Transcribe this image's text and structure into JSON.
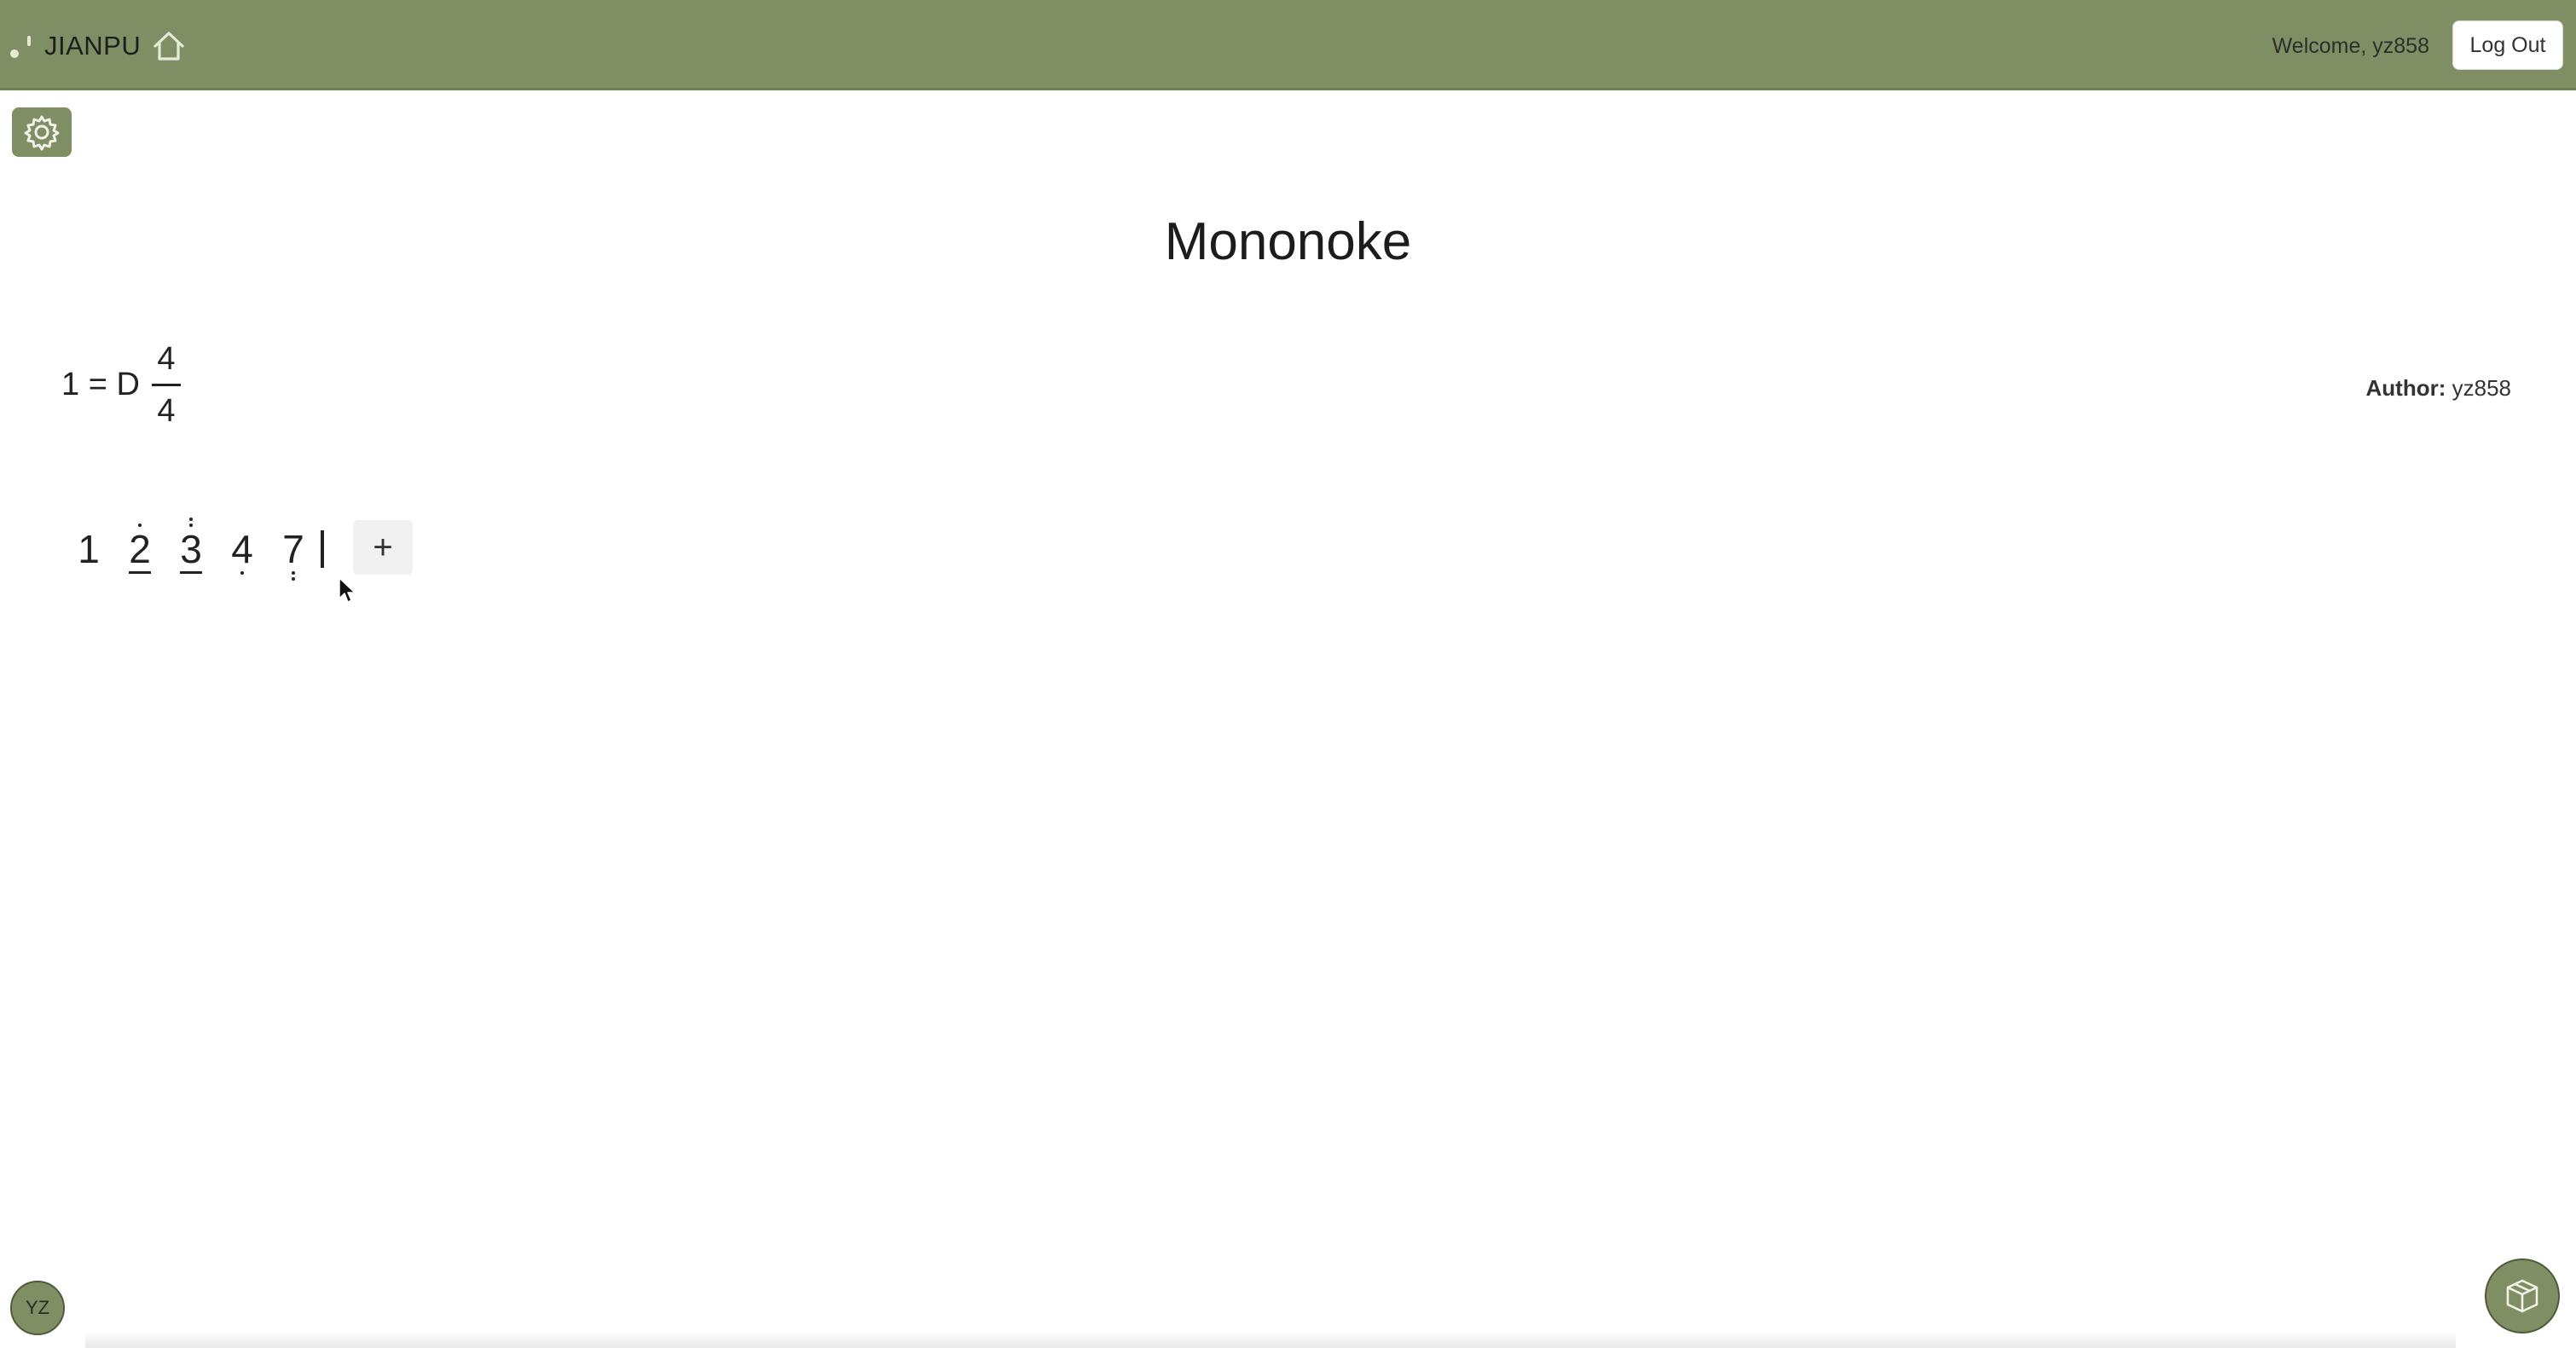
{
  "navbar": {
    "brand": "JIANPU",
    "welcome": "Welcome, yz858",
    "logout_label": "Log Out",
    "background_color": "#7f8f63"
  },
  "icons": {
    "home": "home-icon",
    "settings": "gear-icon",
    "cube": "cube-icon"
  },
  "score": {
    "title": "Mononoke",
    "key_label": "1 = D",
    "time_signature": {
      "numerator": "4",
      "denominator": "4"
    },
    "author_label": "Author:",
    "author_name": "yz858",
    "notes": [
      {
        "digit": "1",
        "dots_above": 0,
        "dots_below": 0,
        "underlines": 0
      },
      {
        "digit": "2",
        "dots_above": 1,
        "dots_below": 0,
        "underlines": 1
      },
      {
        "digit": "3",
        "dots_above": 2,
        "dots_below": 0,
        "underlines": 1
      },
      {
        "digit": "4",
        "dots_above": 0,
        "dots_below": 1,
        "underlines": 0
      },
      {
        "digit": "7",
        "dots_above": 0,
        "dots_below": 2,
        "underlines": 0
      }
    ],
    "add_label": "+"
  },
  "user": {
    "avatar_initials": "YZ"
  }
}
